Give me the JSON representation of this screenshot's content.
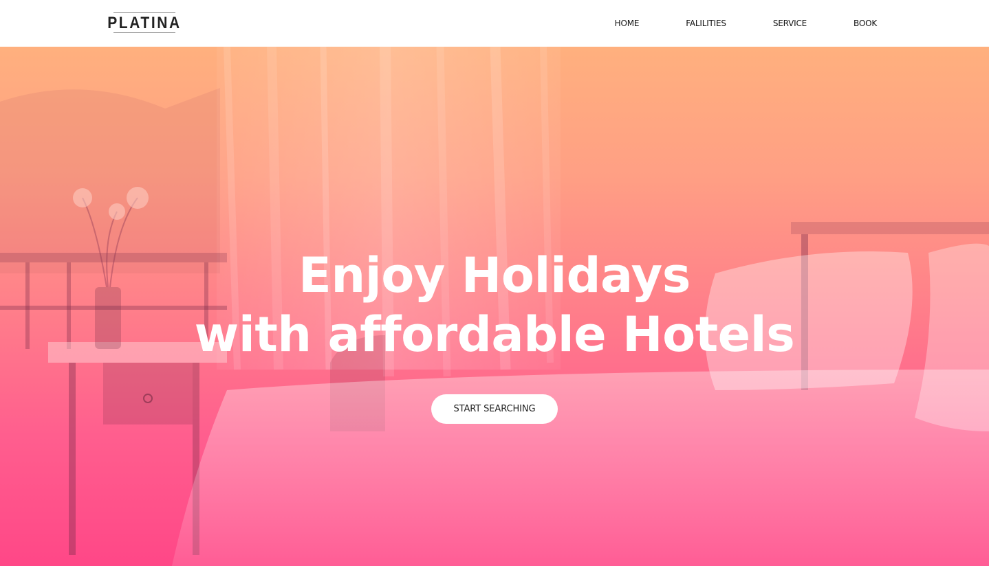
{
  "brand": {
    "logo_text": "PLATINA"
  },
  "nav": {
    "items": [
      {
        "label": "HOME"
      },
      {
        "label": "FALILITIES"
      },
      {
        "label": "SERVICE"
      },
      {
        "label": "BOOK"
      }
    ]
  },
  "hero": {
    "headline_line1": "Enjoy Holidays",
    "headline_line2": "with affordable Hotels",
    "cta_label": "START SEARCHING",
    "gradient_top": "#ffb07e",
    "gradient_bottom": "#ff4787",
    "background_image": "hotel-bedroom-photo"
  },
  "colors": {
    "nav_background": "#ffffff",
    "nav_text": "#111111",
    "headline_text": "#ffffff",
    "button_background": "#ffffff",
    "button_text": "#222222"
  }
}
